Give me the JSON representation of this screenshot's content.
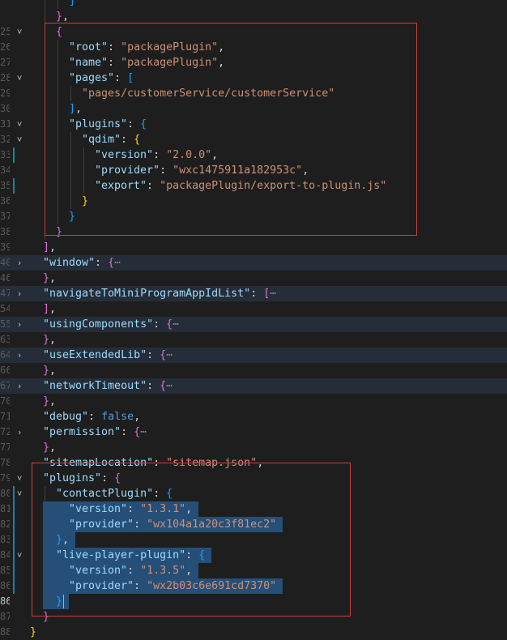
{
  "editor": {
    "colors": {
      "background": "#1e1e1e",
      "key": "#9cdcfe",
      "string": "#ce9178",
      "bracket_gold": "#ffd700",
      "bracket_purple": "#da70d6",
      "bracket_blue": "#179fff",
      "keyword": "#569cd6",
      "selection": "#264f78",
      "annotation_box": "#c6413d"
    },
    "lines": [
      {
        "num": "",
        "fold": "",
        "indent": 2,
        "tokens": [
          [
            "b3",
            "]"
          ]
        ]
      },
      {
        "num": "",
        "fold": "",
        "indent": 1,
        "tokens": [
          [
            "b2",
            "}"
          ],
          [
            "p",
            ","
          ]
        ]
      },
      {
        "num": "25",
        "fold": "open",
        "indent": 1,
        "tokens": [
          [
            "b2",
            "{"
          ]
        ]
      },
      {
        "num": "26",
        "fold": "",
        "indent": 2,
        "tokens": [
          [
            "k",
            "\"root\""
          ],
          [
            "p",
            ": "
          ],
          [
            "s",
            "\"packagePlugin\""
          ],
          [
            "p",
            ","
          ]
        ]
      },
      {
        "num": "27",
        "fold": "",
        "indent": 2,
        "tokens": [
          [
            "k",
            "\"name\""
          ],
          [
            "p",
            ": "
          ],
          [
            "s",
            "\"packagePlugin\""
          ],
          [
            "p",
            ","
          ]
        ]
      },
      {
        "num": "28",
        "fold": "open",
        "indent": 2,
        "tokens": [
          [
            "k",
            "\"pages\""
          ],
          [
            "p",
            ": "
          ],
          [
            "b3",
            "["
          ]
        ]
      },
      {
        "num": "29",
        "fold": "",
        "indent": 3,
        "tokens": [
          [
            "s",
            "\"pages/customerService/customerService\""
          ]
        ]
      },
      {
        "num": "30",
        "fold": "",
        "indent": 2,
        "tokens": [
          [
            "b3",
            "]"
          ],
          [
            "p",
            ","
          ]
        ]
      },
      {
        "num": "31",
        "fold": "open",
        "indent": 2,
        "tokens": [
          [
            "k",
            "\"plugins\""
          ],
          [
            "p",
            ": "
          ],
          [
            "b3",
            "{"
          ]
        ]
      },
      {
        "num": "32",
        "fold": "open",
        "indent": 3,
        "tokens": [
          [
            "k",
            "\"qdim\""
          ],
          [
            "p",
            ": "
          ],
          [
            "b1",
            "{"
          ]
        ]
      },
      {
        "num": "33",
        "fold": "",
        "indent": 4,
        "mod": true,
        "tokens": [
          [
            "k",
            "\"version\""
          ],
          [
            "p",
            ": "
          ],
          [
            "s",
            "\"2.0.0\""
          ],
          [
            "p",
            ","
          ]
        ]
      },
      {
        "num": "34",
        "fold": "",
        "indent": 4,
        "tokens": [
          [
            "k",
            "\"provider\""
          ],
          [
            "p",
            ": "
          ],
          [
            "s",
            "\"wxc1475911a182953c\""
          ],
          [
            "p",
            ","
          ]
        ]
      },
      {
        "num": "35",
        "fold": "",
        "indent": 4,
        "mod": true,
        "tokens": [
          [
            "k",
            "\"export\""
          ],
          [
            "p",
            ": "
          ],
          [
            "s",
            "\"packagePlugin/export-to-plugin.js\""
          ]
        ]
      },
      {
        "num": "36",
        "fold": "",
        "indent": 3,
        "tokens": [
          [
            "b1",
            "}"
          ]
        ]
      },
      {
        "num": "37",
        "fold": "",
        "indent": 2,
        "tokens": [
          [
            "b3",
            "}"
          ]
        ]
      },
      {
        "num": "38",
        "fold": "",
        "indent": 1,
        "tokens": [
          [
            "b2",
            "}"
          ]
        ]
      },
      {
        "num": "39",
        "fold": "",
        "indent": 0,
        "tokens": [
          [
            "b2",
            "]"
          ],
          [
            "p",
            ","
          ]
        ]
      },
      {
        "num": "40",
        "fold": "closed",
        "indent": 0,
        "folded": true,
        "tokens": [
          [
            "k",
            "\"window\""
          ],
          [
            "p",
            ": "
          ],
          [
            "b2",
            "{"
          ],
          [
            "ell",
            "⋯"
          ]
        ]
      },
      {
        "num": "46",
        "fold": "",
        "indent": 0,
        "tokens": [
          [
            "b2",
            "}"
          ],
          [
            "p",
            ","
          ]
        ]
      },
      {
        "num": "47",
        "fold": "closed",
        "indent": 0,
        "folded": true,
        "tokens": [
          [
            "k",
            "\"navigateToMiniProgramAppIdList\""
          ],
          [
            "p",
            ": "
          ],
          [
            "b2",
            "["
          ],
          [
            "ell",
            "⋯"
          ]
        ]
      },
      {
        "num": "54",
        "fold": "",
        "indent": 0,
        "tokens": [
          [
            "b2",
            "]"
          ],
          [
            "p",
            ","
          ]
        ]
      },
      {
        "num": "55",
        "fold": "closed",
        "indent": 0,
        "folded": true,
        "tokens": [
          [
            "k",
            "\"usingComponents\""
          ],
          [
            "p",
            ": "
          ],
          [
            "b2",
            "{"
          ],
          [
            "ell",
            "⋯"
          ]
        ]
      },
      {
        "num": "63",
        "fold": "",
        "indent": 0,
        "tokens": [
          [
            "b2",
            "}"
          ],
          [
            "p",
            ","
          ]
        ]
      },
      {
        "num": "64",
        "fold": "closed",
        "indent": 0,
        "folded": true,
        "tokens": [
          [
            "k",
            "\"useExtendedLib\""
          ],
          [
            "p",
            ": "
          ],
          [
            "b2",
            "{"
          ],
          [
            "ell",
            "⋯"
          ]
        ]
      },
      {
        "num": "66",
        "fold": "",
        "indent": 0,
        "tokens": [
          [
            "b2",
            "}"
          ],
          [
            "p",
            ","
          ]
        ]
      },
      {
        "num": "67",
        "fold": "closed",
        "indent": 0,
        "folded": true,
        "tokens": [
          [
            "k",
            "\"networkTimeout\""
          ],
          [
            "p",
            ": "
          ],
          [
            "b2",
            "{"
          ],
          [
            "ell",
            "⋯"
          ]
        ]
      },
      {
        "num": "70",
        "fold": "",
        "indent": 0,
        "tokens": [
          [
            "b2",
            "}"
          ],
          [
            "p",
            ","
          ]
        ]
      },
      {
        "num": "71",
        "fold": "",
        "indent": 0,
        "tokens": [
          [
            "k",
            "\"debug\""
          ],
          [
            "p",
            ": "
          ],
          [
            "kw",
            "false"
          ],
          [
            "p",
            ","
          ]
        ]
      },
      {
        "num": "72",
        "fold": "closed",
        "indent": 0,
        "tokens": [
          [
            "k",
            "\"permission\""
          ],
          [
            "p",
            ": "
          ],
          [
            "b2",
            "{"
          ],
          [
            "ell",
            "⋯"
          ]
        ]
      },
      {
        "num": "77",
        "fold": "",
        "indent": 0,
        "tokens": [
          [
            "b2",
            "}"
          ],
          [
            "p",
            ","
          ]
        ]
      },
      {
        "num": "78",
        "fold": "",
        "indent": 0,
        "tokens": [
          [
            "k",
            "\"sitemapLocation\""
          ],
          [
            "p",
            ": "
          ],
          [
            "s",
            "\"sitemap.json\""
          ],
          [
            "p",
            ","
          ]
        ]
      },
      {
        "num": "79",
        "fold": "open",
        "indent": 0,
        "tokens": [
          [
            "k",
            "\"plugins\""
          ],
          [
            "p",
            ": "
          ],
          [
            "b2",
            "{"
          ]
        ]
      },
      {
        "num": "80",
        "fold": "open",
        "indent": 1,
        "mod": true,
        "tokens": [
          [
            "k",
            "\"contactPlugin\""
          ],
          [
            "p",
            ": "
          ],
          [
            "b3",
            "{"
          ]
        ]
      },
      {
        "num": "81",
        "fold": "",
        "indent": 2,
        "mod": true,
        "tokens": [
          [
            "k",
            "\"version\""
          ],
          [
            "p",
            ": "
          ],
          [
            "s",
            "\"1.3.1\""
          ],
          [
            "p",
            ","
          ]
        ]
      },
      {
        "num": "82",
        "fold": "",
        "indent": 2,
        "mod": true,
        "tokens": [
          [
            "k",
            "\"provider\""
          ],
          [
            "p",
            ": "
          ],
          [
            "s",
            "\"wx104a1a20c3f81ec2\""
          ]
        ]
      },
      {
        "num": "83",
        "fold": "",
        "indent": 1,
        "mod": true,
        "tokens": [
          [
            "b3",
            "}"
          ],
          [
            "p",
            ","
          ]
        ]
      },
      {
        "num": "84",
        "fold": "open",
        "indent": 1,
        "mod": true,
        "tokens": [
          [
            "k",
            "\"live-player-plugin\""
          ],
          [
            "p",
            ": "
          ],
          [
            "b3",
            "{"
          ]
        ]
      },
      {
        "num": "85",
        "fold": "",
        "indent": 2,
        "mod": true,
        "tokens": [
          [
            "k",
            "\"version\""
          ],
          [
            "p",
            ": "
          ],
          [
            "s",
            "\"1.3.5\""
          ],
          [
            "p",
            ","
          ]
        ]
      },
      {
        "num": "86",
        "fold": "",
        "indent": 2,
        "mod": true,
        "tokens": [
          [
            "k",
            "\"provider\""
          ],
          [
            "p",
            ": "
          ],
          [
            "s",
            "\"wx2b03c6e691cd7370\""
          ]
        ]
      },
      {
        "num": "86",
        "fold": "",
        "indent": 1,
        "active": true,
        "tokens": [
          [
            "b3",
            "}"
          ]
        ]
      },
      {
        "num": "87",
        "fold": "",
        "indent": 0,
        "tokens": [
          [
            "b2",
            "}"
          ]
        ]
      },
      {
        "num": "88",
        "fold": "",
        "indent": -1,
        "tokens": [
          [
            "b1",
            "}"
          ]
        ]
      }
    ]
  }
}
